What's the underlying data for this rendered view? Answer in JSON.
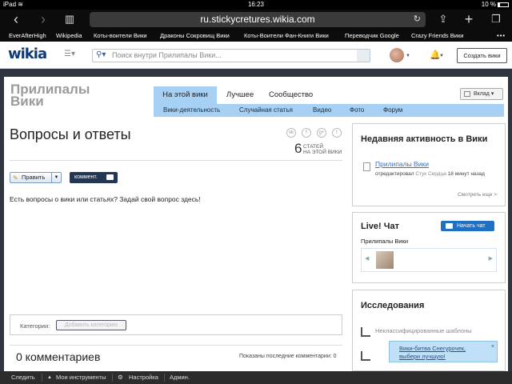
{
  "status_bar": {
    "device": "iPad",
    "wifi": "wifi-icon",
    "time": "16:23",
    "battery": "10 %"
  },
  "browser": {
    "url": "ru.stickycretures.wikia.com",
    "icons": [
      "back-icon",
      "forward-icon",
      "bookmarks-icon",
      "reload-icon",
      "share-icon",
      "new-tab-icon",
      "tabs-icon"
    ]
  },
  "bookmarks": [
    "EverAfterHigh",
    "Wikipedia",
    "Коты-воители Вики",
    "Драконы Сокровищ Вики",
    "Коты-Воители Фан-Книги Вики",
    "Переводчик Google",
    "Crazy Friends Вики"
  ],
  "bookmarks_more": "•••",
  "header": {
    "logo": "wikia",
    "search_placeholder": "Поиск внутри Прилипалы Вики...",
    "create_wiki": "Создать вики"
  },
  "wiki": {
    "name": "Прилипалы Вики",
    "name_line1": "Прилипалы",
    "name_line2": "Вики",
    "tabs": [
      "На этой вики",
      "Лучшее",
      "Сообщество"
    ],
    "subnav": [
      "Вики-деятельность",
      "Случайная статья",
      "Видео",
      "Фото",
      "Форум"
    ],
    "contribute": "Вклад"
  },
  "article": {
    "title": "Вопросы и ответы",
    "count": "6",
    "count_label_1": "СТАТЕЙ",
    "count_label_2": "НА ЭТОЙ ВИКИ",
    "share_icons": [
      "vk",
      "f",
      "g+",
      "t"
    ],
    "edit_label": "Править",
    "comment_label": "коммент.",
    "body": "Есть вопросы о вики или статьях? Задай свой вопрос здесь!",
    "categories_label": "Категории:",
    "add_category": "Добавить категорию",
    "comments_title": "0 комментариев",
    "comments_shown": "Показаны последние комментарии: 0"
  },
  "rail": {
    "activity_title": "Недавняя активность в Вики",
    "activity_link": "Прилипалы Вики",
    "activity_action": "отредактировал",
    "activity_user": "Стук Сердца",
    "activity_time": "18 минут назад",
    "see_more": "Смотреть еще >",
    "chat_title": "Live! Чат",
    "chat_button": "Начать чат",
    "chat_wiki": "Прилипалы Вики",
    "research_title": "Исследования",
    "research_item": "Неклассифицированные шаблоны"
  },
  "toast": {
    "line1": "Вики-битва Снегурочек,",
    "line2": "выбери лучшую!"
  },
  "bottom_bar": {
    "follow": "Следить",
    "tools": "Мои инструменты",
    "settings": "Настройка",
    "admin": "Админ."
  }
}
